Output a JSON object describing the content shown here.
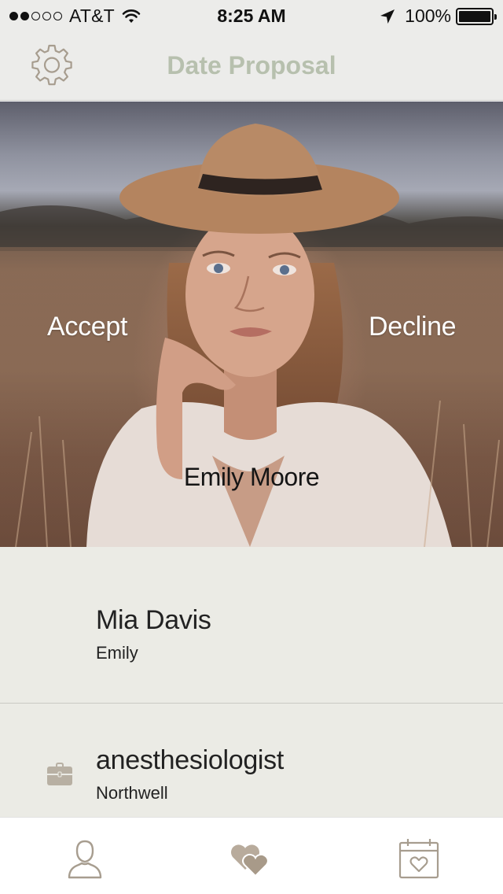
{
  "status_bar": {
    "carrier": "AT&T",
    "time": "8:25 AM",
    "battery": "100%"
  },
  "nav": {
    "title": "Date Proposal",
    "settings_icon": "gear-icon"
  },
  "card": {
    "accept_label": "Accept",
    "decline_label": "Decline",
    "name": "Emily Moore"
  },
  "profile": {
    "name": "Mia Davis",
    "subtitle": "Emily",
    "occupation": "anesthesiologist",
    "employer": "Northwell",
    "occupation_icon": "briefcase-icon"
  },
  "tab_bar": {
    "items": [
      {
        "icon": "person-icon"
      },
      {
        "icon": "hearts-icon"
      },
      {
        "icon": "calendar-heart-icon"
      }
    ]
  },
  "colors": {
    "nav_title": "#b7c0ae",
    "icon_tint": "#a79d8f",
    "info_background": "#ebebe5",
    "chrome_background": "#ececea"
  }
}
